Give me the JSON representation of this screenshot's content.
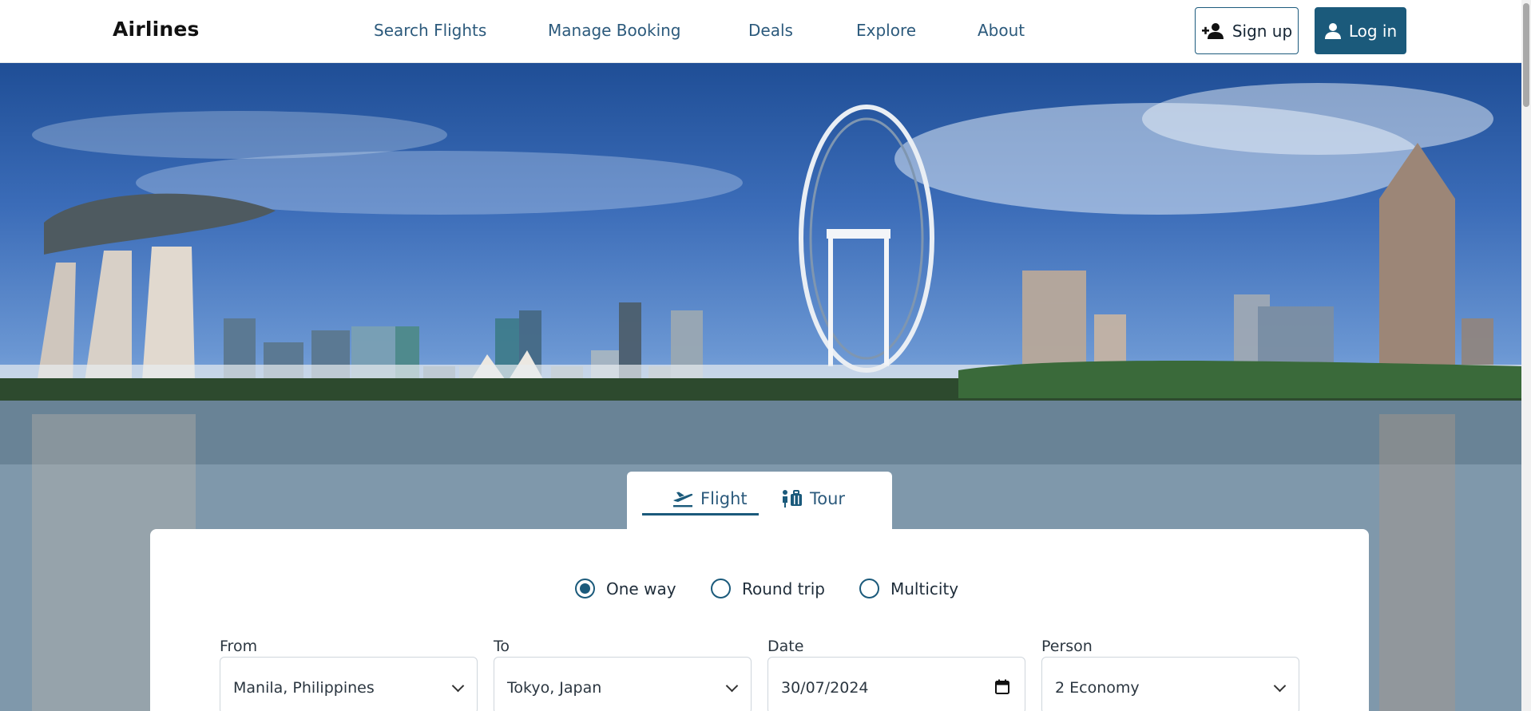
{
  "brand": {
    "name": "Airlines"
  },
  "nav": {
    "items": [
      {
        "label": "Search Flights"
      },
      {
        "label": "Manage Booking"
      },
      {
        "label": "Deals"
      },
      {
        "label": "Explore"
      },
      {
        "label": "About"
      }
    ]
  },
  "auth": {
    "signup_label": "Sign up",
    "login_label": "Log in"
  },
  "colors": {
    "primary": "#1b5a7b",
    "nav_text": "#2c5a7c"
  },
  "search_tabs": [
    {
      "label": "Flight",
      "icon": "airplane-departure-icon",
      "active": true
    },
    {
      "label": "Tour",
      "icon": "luggage-icon",
      "active": false
    }
  ],
  "trip_types": [
    {
      "label": "One way",
      "selected": true
    },
    {
      "label": "Round trip",
      "selected": false
    },
    {
      "label": "Multicity",
      "selected": false
    }
  ],
  "fields": {
    "from": {
      "label": "From",
      "value": "Manila, Philippines"
    },
    "to": {
      "label": "To",
      "value": "Tokyo, Japan"
    },
    "date": {
      "label": "Date",
      "value": "30/07/2024"
    },
    "person": {
      "label": "Person",
      "value": "2 Economy"
    }
  }
}
